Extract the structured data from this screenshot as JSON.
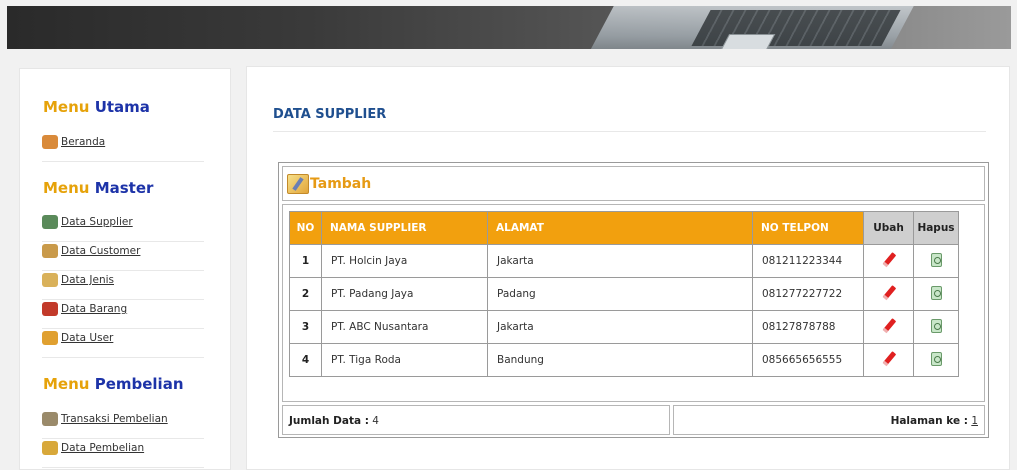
{
  "sidebar": {
    "menu_utama": {
      "a": "Menu",
      "b": "Utama"
    },
    "utama_items": [
      {
        "label": "Beranda",
        "icon": "home-icon"
      }
    ],
    "menu_master": {
      "a": "Menu",
      "b": "Master"
    },
    "master_items": [
      {
        "label": "Data Supplier",
        "icon": "users-icon"
      },
      {
        "label": "Data Customer",
        "icon": "customers-icon"
      },
      {
        "label": "Data Jenis",
        "icon": "category-icon"
      },
      {
        "label": "Data Barang",
        "icon": "box-icon"
      },
      {
        "label": "Data User",
        "icon": "user-icon"
      }
    ],
    "menu_pembelian": {
      "a": "Menu",
      "b": "Pembelian"
    },
    "pembelian_items": [
      {
        "label": "Transaksi Pembelian",
        "icon": "cart-icon"
      },
      {
        "label": "Data Pembelian",
        "icon": "report-icon"
      }
    ]
  },
  "main": {
    "title": "DATA SUPPLIER",
    "add_label": "Tambah",
    "headers": [
      "NO",
      "NAMA SUPPLIER",
      "ALAMAT",
      "NO TELPON",
      "Ubah",
      "Hapus"
    ],
    "rows": [
      {
        "no": "1",
        "nama": "PT. Holcin Jaya",
        "alamat": "Jakarta",
        "telp": "081211223344"
      },
      {
        "no": "2",
        "nama": "PT. Padang Jaya",
        "alamat": "Padang",
        "telp": "081277227722"
      },
      {
        "no": "3",
        "nama": "PT. ABC Nusantara",
        "alamat": "Jakarta",
        "telp": "08127878788"
      },
      {
        "no": "4",
        "nama": "PT. Tiga Roda",
        "alamat": "Bandung",
        "telp": "085665656555"
      }
    ],
    "footer": {
      "jumlah_label": "Jumlah Data :",
      "jumlah_value": "4",
      "halaman_label": "Halaman ke :",
      "halaman_value": "1"
    }
  },
  "colors": {
    "accent_orange": "#f2a00e",
    "menu_blue": "#1d33a8",
    "menu_orange": "#e6a20a",
    "title_blue": "#1f4f8f"
  }
}
